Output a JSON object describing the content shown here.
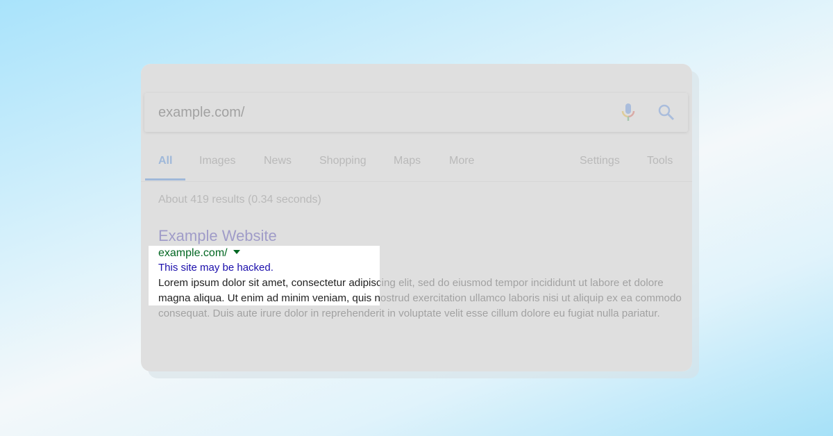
{
  "search": {
    "query": "example.com/"
  },
  "tabs": [
    {
      "label": "All"
    },
    {
      "label": "Images"
    },
    {
      "label": "News"
    },
    {
      "label": "Shopping"
    },
    {
      "label": "Maps"
    },
    {
      "label": "More"
    },
    {
      "label": "Settings"
    },
    {
      "label": "Tools"
    }
  ],
  "result_stats": "About 419 results (0.34 seconds)",
  "result": {
    "title": "Example Website",
    "url": "example.com/",
    "warning": "This site may be hacked.",
    "snippet": "Lorem ipsum dolor sit amet, consectetur adipiscing elit, sed do eiusmod tempor incididunt ut labore et dolore magna aliqua. Ut enim ad minim veniam, quis nostrud exercitation ullamco laboris nisi ut aliquip ex ea commodo consequat. Duis aute irure dolor in reprehenderit in voluptate velit esse cillum dolore eu fugiat nulla pariatur."
  },
  "colors": {
    "accent": "#1a73e8",
    "link": "#1a0dab",
    "url": "#006621"
  }
}
